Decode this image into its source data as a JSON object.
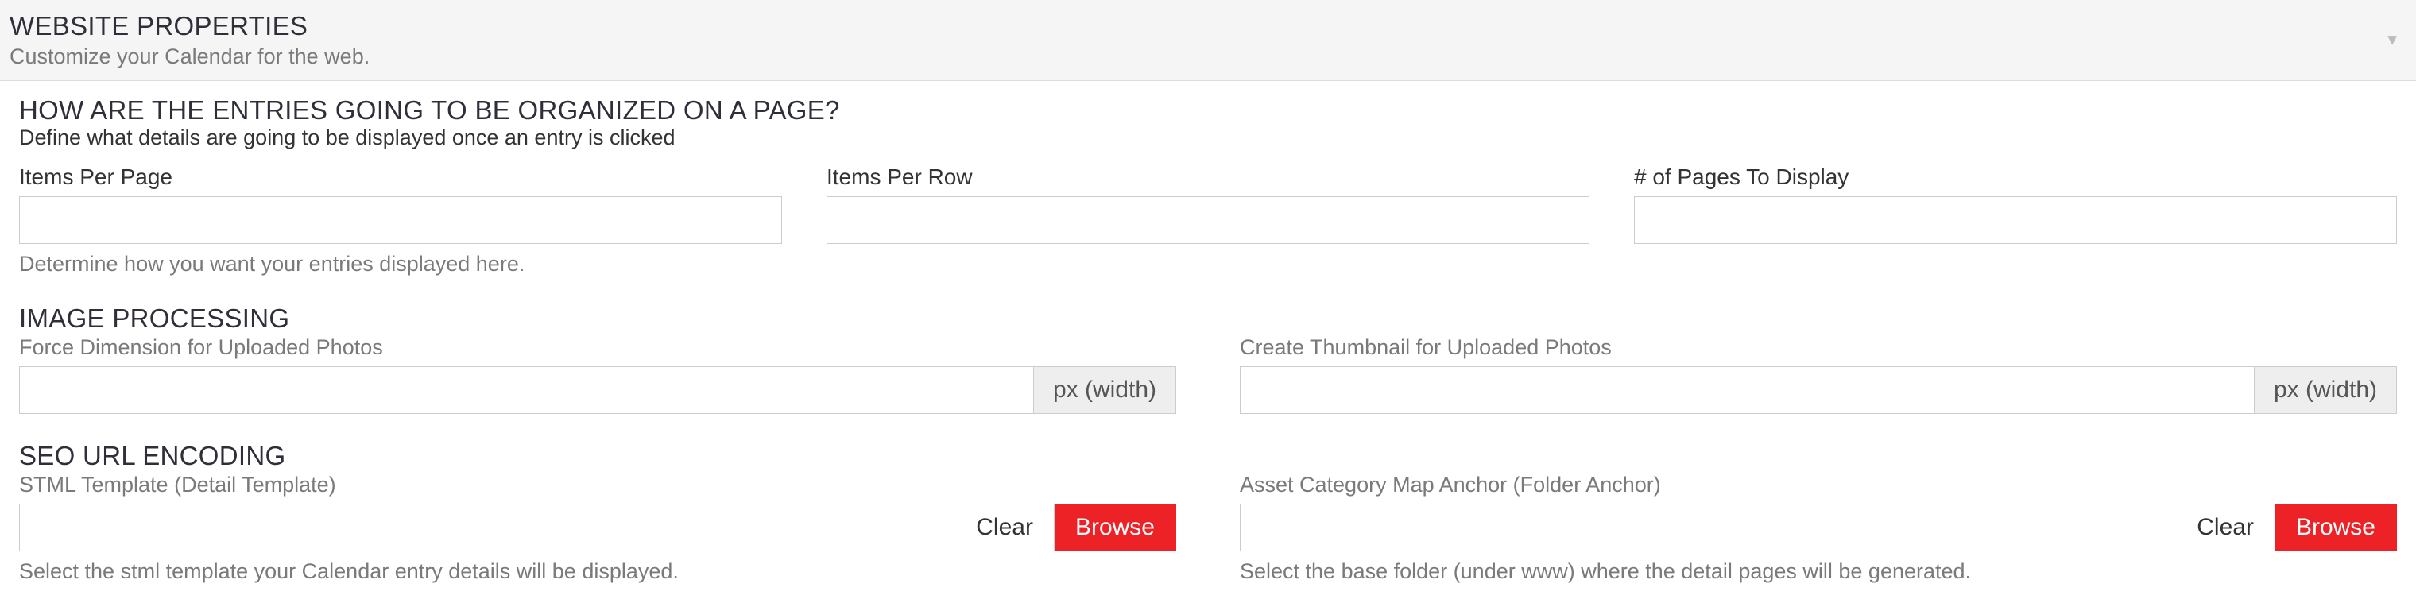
{
  "header": {
    "title": "WEBSITE PROPERTIES",
    "subtitle": "Customize your Calendar for the web."
  },
  "org": {
    "title": "HOW ARE THE ENTRIES GOING TO BE ORGANIZED ON A PAGE?",
    "subtitle": "Define what details are going to be displayed once an entry is clicked",
    "items_per_page_label": "Items Per Page",
    "items_per_row_label": "Items Per Row",
    "pages_to_display_label": "# of Pages To Display",
    "help": "Determine how you want your entries displayed here."
  },
  "image": {
    "title": "IMAGE PROCESSING",
    "force_label": "Force Dimension for Uploaded Photos",
    "thumb_label": "Create Thumbnail for Uploaded Photos",
    "addon": "px (width)"
  },
  "seo": {
    "title": "SEO URL ENCODING",
    "stml_label": "STML Template (Detail Template)",
    "anchor_label": "Asset Category Map Anchor (Folder Anchor)",
    "clear": "Clear",
    "browse": "Browse",
    "stml_help": "Select the stml template your Calendar entry details will be displayed.",
    "anchor_help": "Select the base folder (under www) where the detail pages will be generated."
  }
}
